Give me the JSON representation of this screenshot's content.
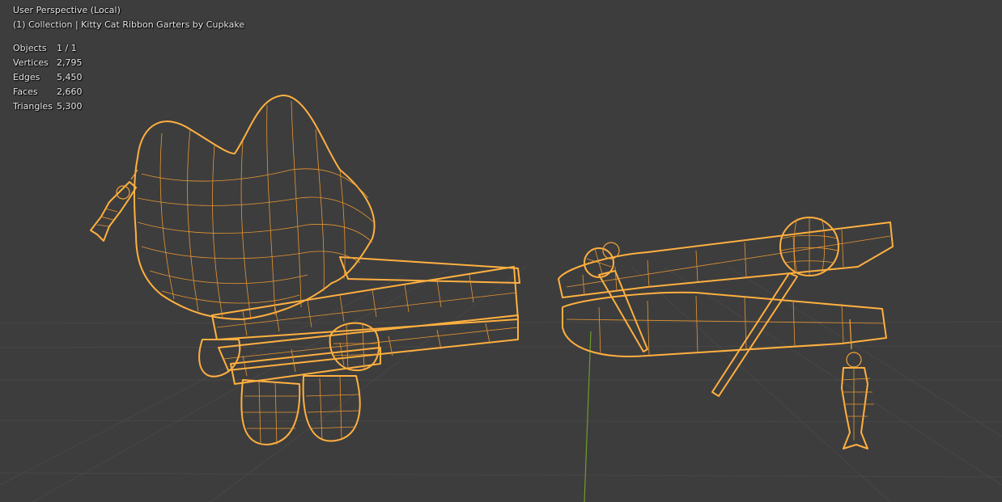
{
  "viewport": {
    "view_name": "User Perspective (Local)",
    "collection_line": "(1) Collection | Kitty Cat Ribbon Garters by Cupkake",
    "stats": [
      {
        "label": "Objects",
        "value": "1 / 1"
      },
      {
        "label": "Vertices",
        "value": "2,795"
      },
      {
        "label": "Edges",
        "value": "5,450"
      },
      {
        "label": "Faces",
        "value": "2,660"
      },
      {
        "label": "Triangles",
        "value": "5,300"
      }
    ]
  },
  "colors": {
    "background": "#3d3d3d",
    "grid": "#474747",
    "wire_selected": "#f2a33a",
    "axis_y": "#6e9d2a"
  }
}
